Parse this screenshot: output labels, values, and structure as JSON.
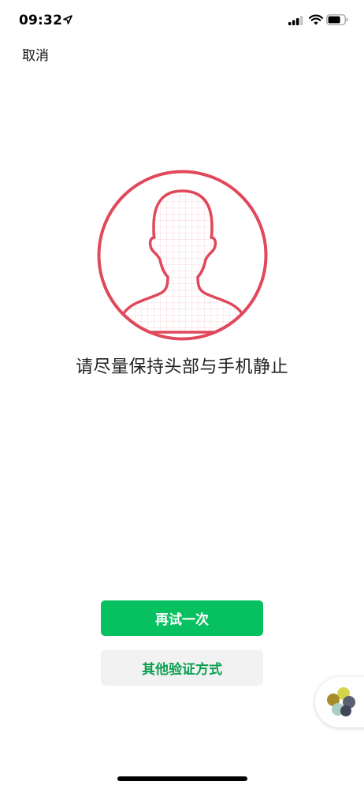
{
  "status_bar": {
    "time": "09:32"
  },
  "nav": {
    "cancel_label": "取消"
  },
  "main": {
    "instruction": "请尽量保持头部与手机静止"
  },
  "actions": {
    "retry_label": "再试一次",
    "other_label": "其他验证方式"
  },
  "colors": {
    "accent": "#07c160",
    "outline": "#e0485b",
    "grid": "#f6c9cf"
  },
  "icons": [
    "location-arrow-icon",
    "signal-icon",
    "wifi-icon",
    "battery-icon",
    "face-outline-icon",
    "app-logo-icon"
  ]
}
